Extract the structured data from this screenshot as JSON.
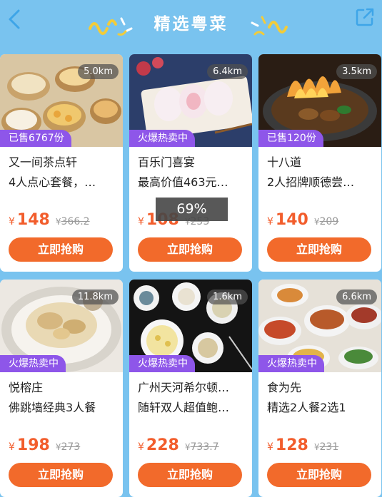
{
  "header": {
    "title": "精选粤菜",
    "back_icon": "chevron-left-icon",
    "share_icon": "share-icon",
    "accent": "#3ea5e8"
  },
  "overlay": {
    "text": "69%"
  },
  "cards": [
    {
      "distance": "5.0km",
      "tag": "已售6767份",
      "name": "又一间茶点轩",
      "desc": "4人点心套餐，…",
      "currency": "¥",
      "price": "148",
      "orig_price": "366.2",
      "buy_label": "立即抢购"
    },
    {
      "distance": "6.4km",
      "tag": "火爆热卖中",
      "name": "百乐门喜宴",
      "desc": "最高价值463元…",
      "currency": "¥",
      "price": "108",
      "orig_price": "253",
      "buy_label": "立即抢购"
    },
    {
      "distance": "3.5km",
      "tag": "已售120份",
      "name": "十八道",
      "desc": "2人招牌顺德尝…",
      "currency": "¥",
      "price": "140",
      "orig_price": "209",
      "buy_label": "立即抢购"
    },
    {
      "distance": "11.8km",
      "tag": "火爆热卖中",
      "name": "悦榕庄",
      "desc": "佛跳墙经典3人餐",
      "currency": "¥",
      "price": "198",
      "orig_price": "273",
      "buy_label": "立即抢购"
    },
    {
      "distance": "1.6km",
      "tag": "火爆热卖中",
      "name": "广州天河希尔顿…",
      "desc": "随轩双人超值鲍…",
      "currency": "¥",
      "price": "228",
      "orig_price": "733.7",
      "buy_label": "立即抢购"
    },
    {
      "distance": "6.6km",
      "tag": "火爆热卖中",
      "name": "食为先",
      "desc": "精选2人餐2选1",
      "currency": "¥",
      "price": "128",
      "orig_price": "231",
      "buy_label": "立即抢购"
    }
  ]
}
